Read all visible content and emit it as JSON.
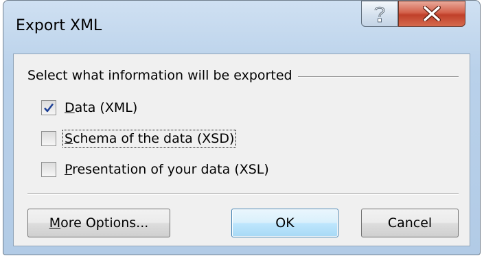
{
  "window": {
    "title": "Export XML",
    "help_icon": "help-question-icon",
    "close_icon": "close-x-icon"
  },
  "group": {
    "label": "Select what information will be exported"
  },
  "options": [
    {
      "label": "Data (XML)",
      "accesskey": "D",
      "checked": true
    },
    {
      "label": "Schema of the data (XSD)",
      "accesskey": "S",
      "checked": false,
      "focused": true
    },
    {
      "label": "Presentation of your data (XSL)",
      "accesskey": "P",
      "checked": false
    }
  ],
  "buttons": {
    "more_options": "More Options...",
    "more_options_accesskey": "M",
    "ok": "OK",
    "cancel": "Cancel"
  },
  "colors": {
    "close_button": "#c74a33",
    "ok_button_border": "#3c7fb1",
    "title_bar": "#b9d1ea"
  }
}
